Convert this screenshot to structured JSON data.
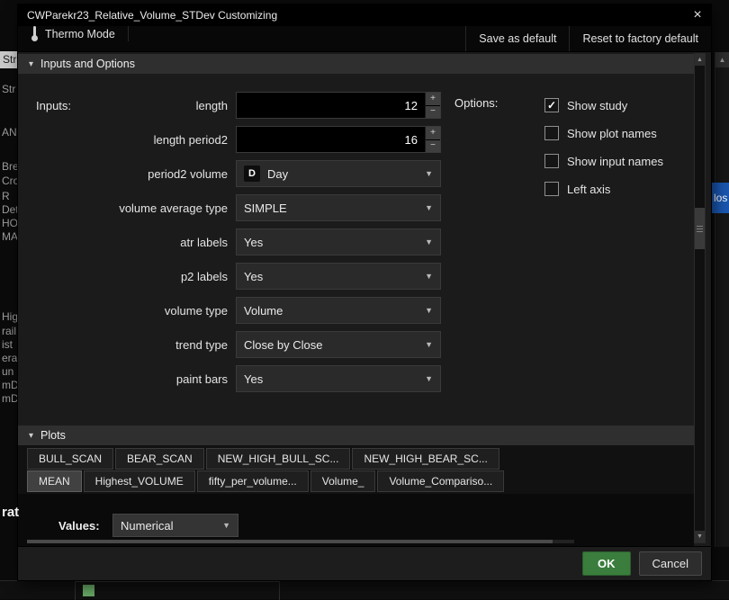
{
  "window": {
    "title": "CWParekr23_Relative_Volume_STDev Customizing"
  },
  "icons": {
    "close": "×",
    "chevron_down": "▾",
    "dropdown_arrow": "▼",
    "plus": "+",
    "minus": "−",
    "scroll_up": "▲",
    "scroll_down": "▼"
  },
  "toolbar": {
    "thermo_mode": "Thermo Mode",
    "save_as_default": "Save as default",
    "reset_to_factory_default": "Reset to factory default"
  },
  "sections": {
    "inputs_and_options": "Inputs and Options",
    "plots": "Plots"
  },
  "inputs": {
    "heading": "Inputs:",
    "rows": [
      {
        "label": "length",
        "value": "12"
      },
      {
        "label": "length period2",
        "value": "16"
      },
      {
        "label": "period2 volume",
        "badge": "D",
        "value": "Day"
      },
      {
        "label": "volume average type",
        "value": "SIMPLE"
      },
      {
        "label": "atr labels",
        "value": "Yes"
      },
      {
        "label": "p2 labels",
        "value": "Yes"
      },
      {
        "label": "volume type",
        "value": "Volume"
      },
      {
        "label": "trend type",
        "value": "Close by Close"
      },
      {
        "label": "paint bars",
        "value": "Yes"
      }
    ]
  },
  "options": {
    "heading": "Options:",
    "checkboxes": [
      {
        "label": "Show study",
        "mark": "✓"
      },
      {
        "label": "Show plot names",
        "mark": ""
      },
      {
        "label": "Show input names",
        "mark": ""
      },
      {
        "label": "Left axis",
        "mark": ""
      }
    ]
  },
  "plots": {
    "row1": [
      {
        "label": "BULL_SCAN"
      },
      {
        "label": "BEAR_SCAN"
      },
      {
        "label": "NEW_HIGH_BULL_SC..."
      },
      {
        "label": "NEW_HIGH_BEAR_SC..."
      }
    ],
    "row2": [
      {
        "label": "MEAN"
      },
      {
        "label": "Highest_VOLUME"
      },
      {
        "label": "fifty_per_volume..."
      },
      {
        "label": "Volume_"
      },
      {
        "label": "Volume_Compariso..."
      }
    ]
  },
  "values": {
    "label": "Values:",
    "selected": "Numerical"
  },
  "footer": {
    "ok": "OK",
    "cancel": "Cancel"
  },
  "background": {
    "fragments": [
      "Str",
      "Str",
      "ANC",
      "Brea",
      "Cros",
      "R",
      "Dete",
      "HOR",
      "MA",
      "High",
      "rail",
      "ist",
      "era",
      "un",
      "mD",
      "mD",
      "rat"
    ],
    "right_selected": "los"
  },
  "colors": {
    "ok_green": "#3a7d3c",
    "selection_blue": "#1a57b0"
  }
}
